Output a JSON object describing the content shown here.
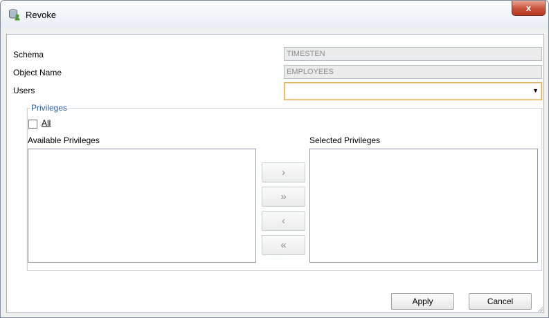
{
  "window": {
    "title": "Revoke",
    "close_symbol": "x",
    "icon": "database-user-icon"
  },
  "form": {
    "schema_label": "Schema",
    "schema_value": "TIMESTEN",
    "object_name_label": "Object Name",
    "object_name_value": "EMPLOYEES",
    "users_label": "Users",
    "users_value": ""
  },
  "privileges": {
    "group_title": "Privileges",
    "all_label": "All",
    "all_checked": false,
    "available_title": "Available Privileges",
    "selected_title": "Selected Privileges",
    "available_items": [],
    "selected_items": [],
    "move_buttons": {
      "move_one_right": "›",
      "move_all_right": "»",
      "move_one_left": "‹",
      "move_all_left": "«"
    }
  },
  "footer": {
    "apply_label": "Apply",
    "cancel_label": "Cancel"
  },
  "colors": {
    "accent_focus": "#e3a34d",
    "group_title": "#2c5aa0",
    "close_button": "#c9513a"
  }
}
